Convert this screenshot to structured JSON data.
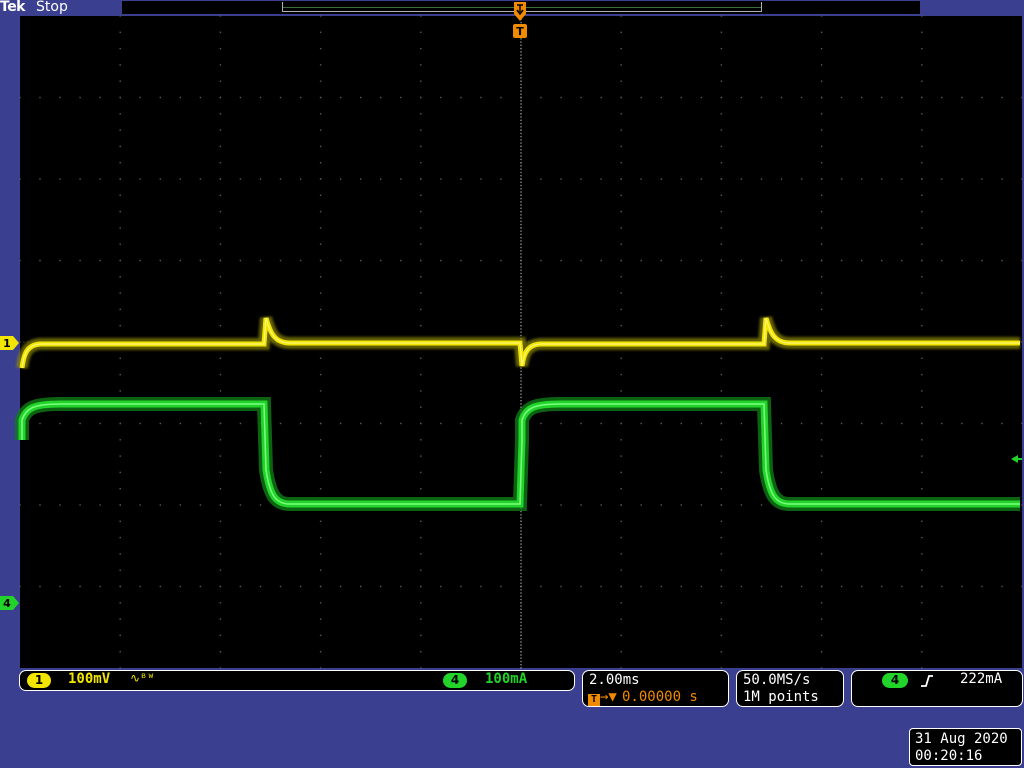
{
  "header": {
    "brand": "Tek",
    "run_state": "Stop"
  },
  "markers": {
    "trigger_label": "T",
    "ch1_label": "1",
    "ch4_label": "4"
  },
  "channels": [
    {
      "number": "1",
      "scale": "100mV",
      "coupling_icon": "bandwidth-limit-icon",
      "color": "#f2e600"
    },
    {
      "number": "4",
      "scale": "100mA",
      "color": "#22d42a"
    }
  ],
  "timebase": {
    "scale": "2.00ms",
    "trigger_position": "0.00000 s"
  },
  "acquisition": {
    "sample_rate": "50.0MS/s",
    "record_length": "1M points"
  },
  "trigger": {
    "source": "4",
    "slope_icon": "rising-edge-icon",
    "level": "222mA"
  },
  "datetime": {
    "date": "31 Aug 2020",
    "time": "00:20:16"
  },
  "colors": {
    "background": "#3a3f90",
    "graticule": "#000000",
    "trigger_orange": "#f08a00",
    "ch1": "#f2e600",
    "ch4": "#22d42a"
  }
}
